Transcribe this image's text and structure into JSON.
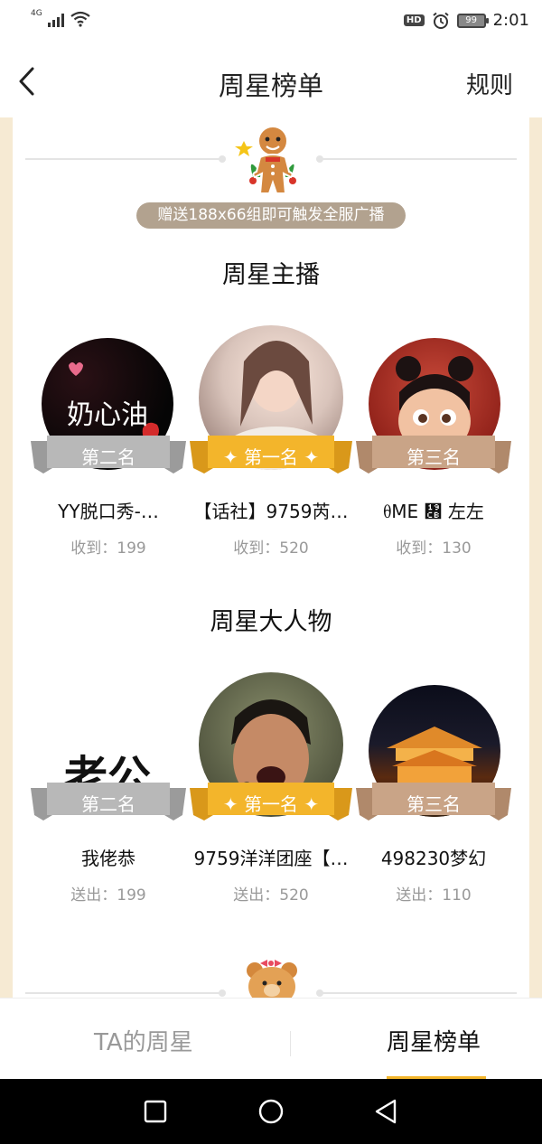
{
  "status_bar": {
    "network": "4G",
    "time": "2:01",
    "battery": "99",
    "hd": "HD"
  },
  "nav": {
    "title": "周星榜单",
    "rule_label": "规则"
  },
  "broadcast_banner": "赠送188x66组即可触发全服广播",
  "sections": {
    "anchor": {
      "title": "周星主播",
      "entries": [
        {
          "rank_label": "第二名",
          "name": "YY脱口秀-…",
          "stat": "收到：199",
          "avatar_text": "奶心油"
        },
        {
          "rank_label": "第一名",
          "name": "【话社】9759芮…",
          "stat": "收到：520"
        },
        {
          "rank_label": "第三名",
          "name": "ᦲME ᧋ 左左",
          "stat": "收到：130"
        }
      ]
    },
    "big_shot": {
      "title": "周星大人物",
      "entries": [
        {
          "rank_label": "第二名",
          "name": "我佬恭",
          "stat": "送出：199",
          "avatar_text": "老公"
        },
        {
          "rank_label": "第一名",
          "name": "9759洋洋团座【…",
          "stat": "送出：520"
        },
        {
          "rank_label": "第三名",
          "name": "498230梦幻",
          "stat": "送出：110"
        }
      ]
    }
  },
  "tabs": [
    {
      "label": "TA的周星",
      "active": false
    },
    {
      "label": "周星榜单",
      "active": true
    }
  ],
  "colors": {
    "gold": "#f3b52b",
    "silver": "#b8b8b8",
    "bronze": "#c9a487",
    "panel_bg": "#f6ead3",
    "banner_bg": "#b2a28f"
  }
}
